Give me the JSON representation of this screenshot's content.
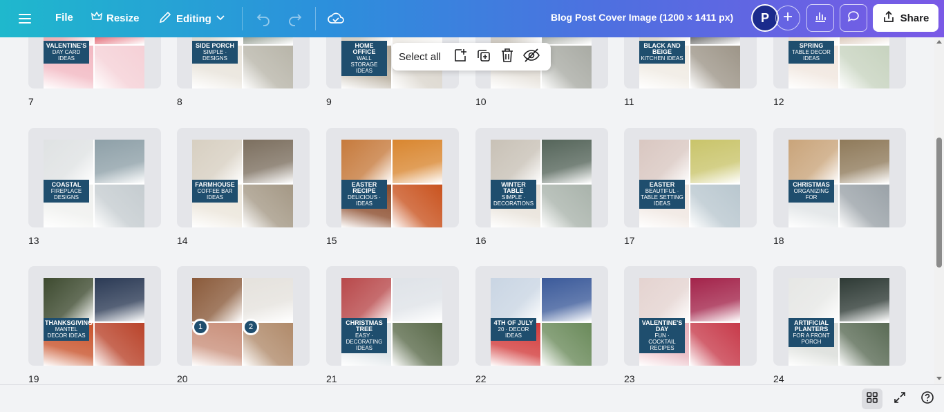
{
  "topbar": {
    "file_label": "File",
    "resize_label": "Resize",
    "editing_label": "Editing",
    "doc_title": "Blog Post Cover Image (1200 × 1411 px)",
    "avatar_initial": "P",
    "share_label": "Share"
  },
  "context_menu": {
    "select_all_label": "Select all"
  },
  "pages": [
    {
      "num": "7",
      "label_bold": "Valentine's",
      "label_text": "Day Card Ideas",
      "colors": [
        "#e9a3a7",
        "#d93b4a",
        "#f2b7c1",
        "#f5d0d6"
      ]
    },
    {
      "num": "8",
      "label_bold": "Side Porch",
      "label_text": "Simple · Designs",
      "colors": [
        "#d9d4c9",
        "#6f7b6b",
        "#e8e3da",
        "#b8b5a9"
      ]
    },
    {
      "num": "9",
      "label_bold": "Home Office",
      "label_text": "Wall Storage Ideas",
      "colors": [
        "#cdc5b8",
        "#e6e1d8",
        "#b3a998",
        "#dad5cc"
      ]
    },
    {
      "num": "10",
      "label_bold": "",
      "label_text": "",
      "colors": [
        "#c9c3b9",
        "#8a8f86",
        "#e3ded6",
        "#a9aba4"
      ]
    },
    {
      "num": "11",
      "label_bold": "Black and Beige",
      "label_text": "Kitchen Ideas",
      "colors": [
        "#d8d0c4",
        "#3a3a37",
        "#efeae2",
        "#9d9588"
      ]
    },
    {
      "num": "12",
      "label_bold": "Spring",
      "label_text": "Table Decor Ideas",
      "colors": [
        "#e7d7c8",
        "#cfb7a4",
        "#f0e6de",
        "#c7d3bf"
      ]
    },
    {
      "num": "13",
      "label_bold": "Coastal",
      "label_text": "Fireplace Designs",
      "colors": [
        "#dfe2e3",
        "#8ea0a8",
        "#eff0ee",
        "#c5ccd0"
      ]
    },
    {
      "num": "14",
      "label_bold": "Farmhouse",
      "label_text": "Coffee Bar Ideas",
      "colors": [
        "#d7cfc1",
        "#7c6f5f",
        "#ebe5da",
        "#a49885"
      ]
    },
    {
      "num": "15",
      "label_bold": "Easter Recipe",
      "label_text": "Delicious · Ideas",
      "colors": [
        "#c67a3c",
        "#d9862f",
        "#8a4a2a",
        "#c9531f"
      ]
    },
    {
      "num": "16",
      "label_bold": "Winter Table",
      "label_text": "Simple · Decorations",
      "colors": [
        "#c8c1b6",
        "#55655a",
        "#e7e1d8",
        "#a9b3ab"
      ]
    },
    {
      "num": "17",
      "label_bold": "Easter",
      "label_text": "Beautiful · Table Setting Ideas",
      "colors": [
        "#d9c7c1",
        "#c9c46a",
        "#efe6e0",
        "#b9c7cf"
      ]
    },
    {
      "num": "18",
      "label_bold": "Christmas",
      "label_text": "Organizing for",
      "colors": [
        "#c9a47a",
        "#8f7a5a",
        "#dfe3e5",
        "#9aa2a8"
      ]
    },
    {
      "num": "19",
      "label_bold": "Thanksgiving",
      "label_text": "Mantel Decor Ideas",
      "colors": [
        "#3d4a2f",
        "#2b3a55",
        "#c8522a",
        "#b9432a"
      ]
    },
    {
      "num": "20",
      "label_bold": "",
      "label_text": "",
      "colors": [
        "#8a5a3a",
        "#e5e2dd",
        "#c98f7a",
        "#b08a6a"
      ]
    },
    {
      "num": "21",
      "label_bold": "Christmas Tree",
      "label_text": "Easy · Decorating Ideas",
      "colors": [
        "#b8484a",
        "#dfe3e8",
        "#d9e0e4",
        "#5a6a4a"
      ]
    },
    {
      "num": "22",
      "label_bold": "4th of July",
      "label_text": "20 · Decor Ideas",
      "colors": [
        "#c9d5e3",
        "#3b5a9a",
        "#d23a3a",
        "#6a8a5a"
      ]
    },
    {
      "num": "23",
      "label_bold": "Valentine's Day",
      "label_text": "Fun · Cocktail Recipes",
      "colors": [
        "#e4d3d0",
        "#a3234a",
        "#e8b3bc",
        "#c73a4a"
      ]
    },
    {
      "num": "24",
      "label_bold": "Artificial Planters",
      "label_text": "For a Front Porch",
      "colors": [
        "#e6e7e5",
        "#2e3a35",
        "#d9dcd8",
        "#5a6b55"
      ]
    }
  ],
  "page20_badges": [
    "1",
    "2"
  ]
}
